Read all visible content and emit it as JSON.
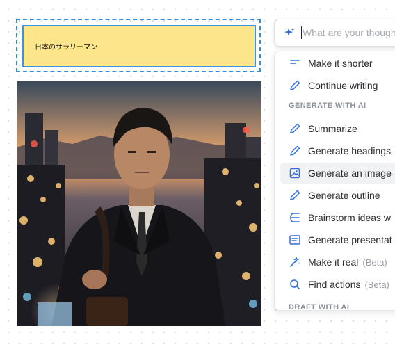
{
  "sticky": {
    "text": "日本のサラリーマン"
  },
  "photo": {
    "alt": "Salaryman in a dark suit in front of a night city skyline"
  },
  "ai": {
    "placeholder": "What are your thoughts?",
    "items": [
      {
        "label": "Make it shorter",
        "icon": "short-text-icon"
      },
      {
        "label": "Continue writing",
        "icon": "pencil-icon"
      },
      {
        "label": "Summarize",
        "icon": "pencil-icon"
      },
      {
        "label": "Generate headings",
        "icon": "pencil-icon"
      },
      {
        "label": "Generate an image",
        "icon": "image-icon"
      },
      {
        "label": "Generate outline",
        "icon": "pencil-icon"
      },
      {
        "label": "Brainstorm ideas w",
        "icon": "brainstorm-icon"
      },
      {
        "label": "Generate presentat",
        "icon": "presentation-icon"
      },
      {
        "label": "Make it real",
        "icon": "magic-wand-icon",
        "badge": "(Beta)"
      },
      {
        "label": "Find actions",
        "icon": "search-icon",
        "badge": "(Beta)"
      }
    ],
    "sections": [
      "GENERATE WITH AI",
      "DRAFT WITH AI"
    ]
  },
  "colors": {
    "sticky_bg": "#fde68a",
    "selection": "#2e8fe0",
    "accent": "#2f6fd6"
  }
}
